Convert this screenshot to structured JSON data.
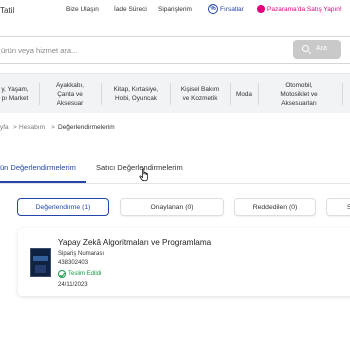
{
  "header": {
    "brand": "Tatil",
    "links": [
      "Bize Ulaşın",
      "İade Süreci",
      "Siparişlerim"
    ],
    "firsatlar": "Fırsatlar",
    "pazarama": "Pazarama'da Satış Yapın!"
  },
  "search": {
    "placeholder": "ürün veya hizmet ara...",
    "button": "Ara"
  },
  "categories": [
    "y, Yaşam,\npı Market",
    "Ayakkabı,\nÇanta ve\nAksesuar",
    "Kitap, Kırtasiye,\nHobi, Oyuncak",
    "Kişisel Bakım\nve Kozmetik",
    "Moda",
    "Otomobil,\nMotosiklet ve\nAksesuarları"
  ],
  "breadcrumb": {
    "home": "yfa",
    "account": "Hesabım",
    "current": "Değerlendirmelerim",
    "sep": ">"
  },
  "tabs": {
    "product": "ün Değerlendirmelerim",
    "seller": "Satıcı Değerlendirmelerim"
  },
  "filters": [
    "Değerlendirme (1)",
    "Onaylanan (0)",
    "Reddedilen (0)",
    "S"
  ],
  "review_item": {
    "title": "Yapay Zekâ Algoritmaları ve Programlama",
    "order_label": "Sipariş Numarası",
    "order_number": "438302403",
    "status": "Teslim Edildi",
    "date": "24/11/2023"
  },
  "colors": {
    "accent": "#2446a8",
    "pazarama": "#e5007d",
    "delivered": "#1a9a4a",
    "category_bg": "#f2f3f5"
  },
  "icons": {
    "firsat": "percent-badge-icon",
    "pazarama": "pazarama-dot-icon",
    "search": "search-icon",
    "status": "check-circle-icon",
    "cursor": "hand-pointer-icon"
  }
}
